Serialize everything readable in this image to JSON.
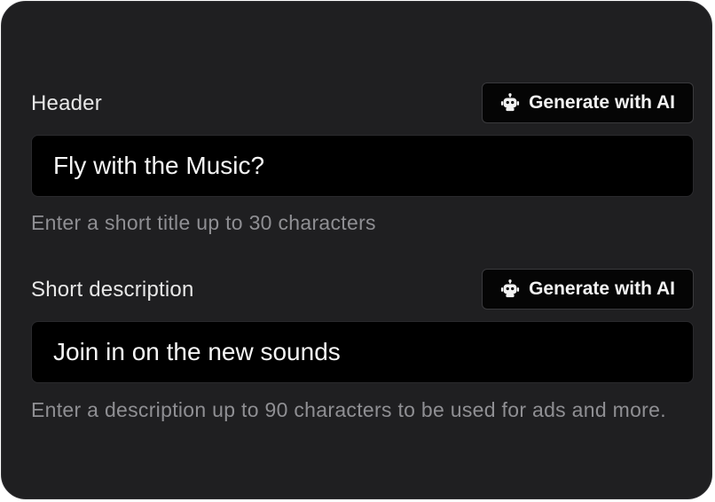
{
  "fields": [
    {
      "label": "Header",
      "ai_button_label": "Generate with AI",
      "ai_button_icon": "robot-icon",
      "value": "Fly with the Music?",
      "helper": "Enter a short title up to 30 characters"
    },
    {
      "label": "Short description",
      "ai_button_label": "Generate with AI",
      "ai_button_icon": "robot-icon",
      "value": "Join in on the new sounds",
      "helper": "Enter a description up to 90 characters to be used for ads and more."
    }
  ],
  "colors": {
    "panel_background": "#1f1f21",
    "input_background": "#000000",
    "button_background": "#050505",
    "label_text": "#e7e7e7",
    "helper_text": "#8f8f93"
  }
}
